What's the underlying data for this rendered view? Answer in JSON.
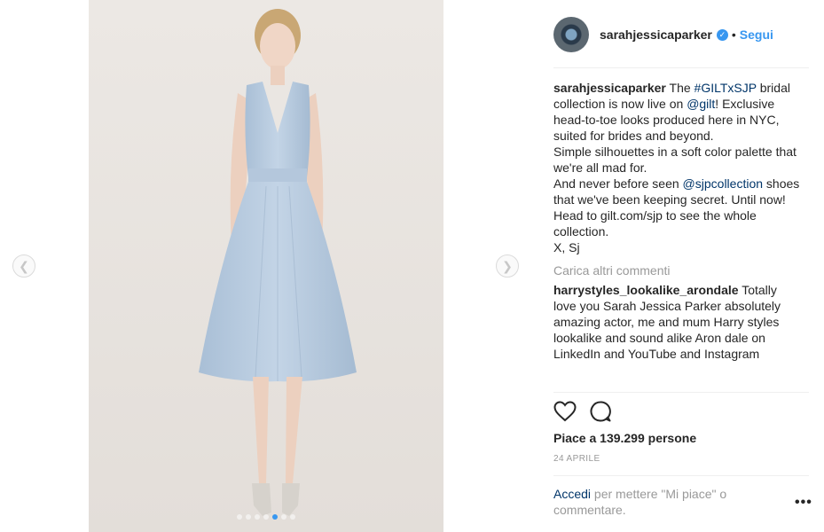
{
  "post": {
    "username": "sarahjessicaparker",
    "follow_label": "Segui",
    "bullet": "•",
    "caption": {
      "username": "sarahjessicaparker",
      "pre": " The ",
      "hashtag": "#GILTxSJP",
      "mid1": " bridal collection is now live on ",
      "mention_gilt": "@gilt",
      "mid2": "! Exclusive head-to-toe looks produced here in NYC, suited for brides and beyond.",
      "line2": "Simple silhouettes in a soft color palette that we're all mad for.",
      "line3_pre": "And never before seen ",
      "mention_sjp": "@sjpcollection",
      "line3_post": " shoes that we've been keeping secret. Until now!",
      "line4": "Head to gilt.com/sjp to see the whole collection.",
      "line5": "X, Sj"
    },
    "load_more": "Carica altri commenti",
    "comment": {
      "username": "harrystyles_lookalike_arondale",
      "text": " Totally love you Sarah Jessica Parker absolutely amazing actor, me and mum Harry styles lookalike and sound alike Aron dale on LinkedIn and YouTube and Instagram"
    },
    "likes": "Piace a 139.299 persone",
    "date": "24 APRILE",
    "login": {
      "link": "Accedi",
      "rest": " per mettere \"Mi piace\" o commentare."
    },
    "more": "•••",
    "carousel": {
      "total": 7,
      "active_index": 4
    }
  },
  "icons": {
    "prev": "chevron-left-icon",
    "next": "chevron-right-icon",
    "like": "heart-icon",
    "comment": "comment-icon",
    "verified": "verified-badge-icon"
  },
  "colors": {
    "accent": "#3897f0",
    "link": "#003569",
    "muted": "#999999",
    "text": "#262626"
  }
}
